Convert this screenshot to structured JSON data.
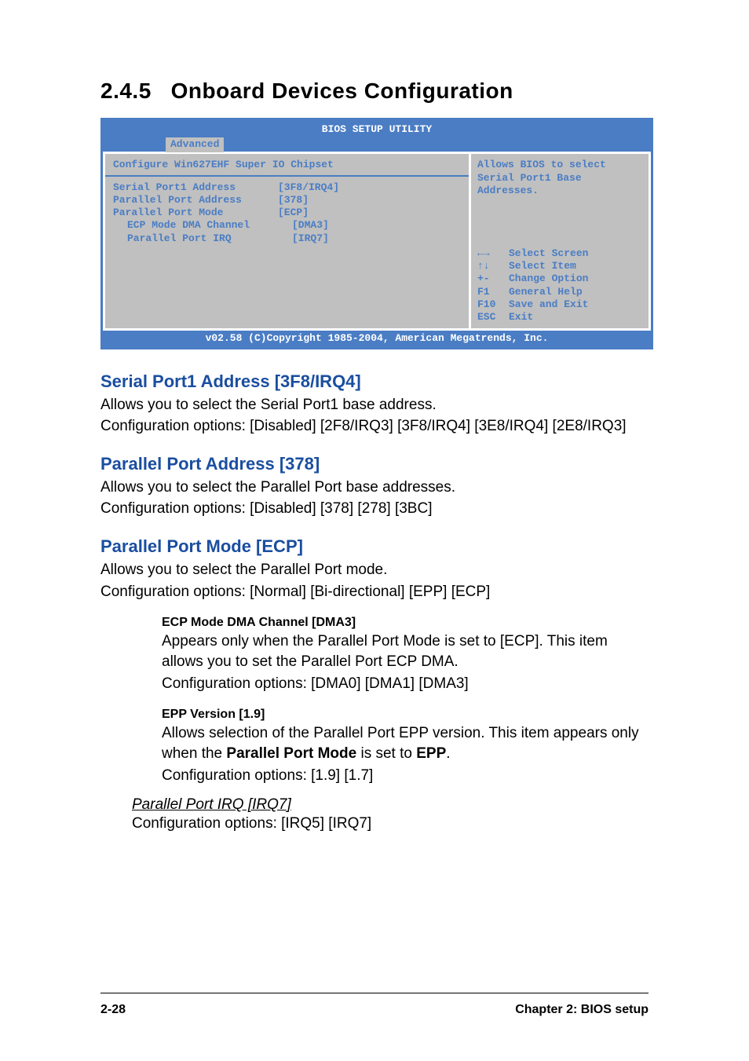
{
  "section_number": "2.4.5",
  "section_title": "Onboard Devices Configuration",
  "bios": {
    "title": "BIOS SETUP UTILITY",
    "tab": "Advanced",
    "config_heading": "Configure Win627EHF Super IO Chipset",
    "settings": [
      {
        "label": "Serial Port1 Address",
        "value": "[3F8/IRQ4]",
        "indent": false
      },
      {
        "label": "Parallel Port Address",
        "value": "[378]",
        "indent": false
      },
      {
        "label": "Parallel Port Mode",
        "value": "[ECP]",
        "indent": false
      },
      {
        "label": "ECP Mode DMA Channel",
        "value": "[DMA3]",
        "indent": true
      },
      {
        "label": "Parallel Port IRQ",
        "value": "[IRQ7]",
        "indent": true
      }
    ],
    "help_top": "Allows BIOS to select Serial Port1 Base Addresses.",
    "help_keys": [
      {
        "key": "←→",
        "desc": "Select Screen"
      },
      {
        "key": "↑↓",
        "desc": "Select Item"
      },
      {
        "key": "+-",
        "desc": "Change Option"
      },
      {
        "key": "F1",
        "desc": "General Help"
      },
      {
        "key": "F10",
        "desc": "Save and Exit"
      },
      {
        "key": "ESC",
        "desc": "Exit"
      }
    ],
    "footer": "v02.58 (C)Copyright 1985-2004, American Megatrends, Inc."
  },
  "sections": {
    "serial": {
      "heading": "Serial Port1 Address [3F8/IRQ4]",
      "p1": "Allows you to select the Serial Port1 base address.",
      "p2": "Configuration options: [Disabled] [2F8/IRQ3] [3F8/IRQ4] [3E8/IRQ4] [2E8/IRQ3]"
    },
    "paraddr": {
      "heading": "Parallel Port Address [378]",
      "p1": "Allows you to select the Parallel Port base addresses.",
      "p2": "Configuration options: [Disabled] [378] [278] [3BC]"
    },
    "parmode": {
      "heading": "Parallel Port Mode [ECP]",
      "p1": "Allows you to select the Parallel Port  mode.",
      "p2": "Configuration options: [Normal] [Bi-directional] [EPP] [ECP]"
    },
    "ecp": {
      "heading": "ECP Mode DMA Channel [DMA3]",
      "p1": "Appears only when the Parallel Port Mode is set to [ECP]. This item allows you to set the Parallel Port ECP DMA.",
      "p2": "Configuration options: [DMA0] [DMA1] [DMA3]"
    },
    "epp": {
      "heading": "EPP Version [1.9]",
      "p1a": "Allows selection of the Parallel Port EPP version. This item appears only when the ",
      "p1b": "Parallel Port Mode",
      "p1c": " is set to ",
      "p1d": "EPP",
      "p1e": ".",
      "p2": "Configuration options: [1.9] [1.7]"
    },
    "irq": {
      "heading": "Parallel Port IRQ [IRQ7]",
      "p1": "Configuration options: [IRQ5] [IRQ7]"
    }
  },
  "footer": {
    "left": "2-28",
    "right": "Chapter 2: BIOS setup"
  }
}
